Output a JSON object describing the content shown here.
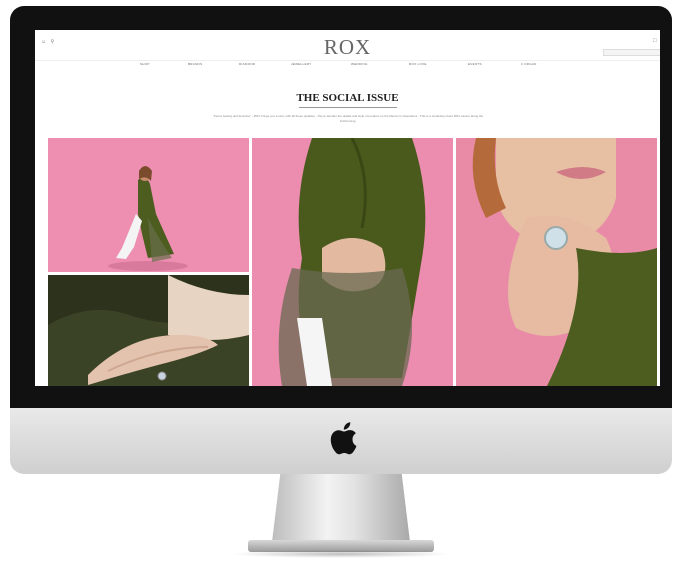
{
  "site": {
    "logo": "ROX",
    "left_icons": [
      "user-icon",
      "search-icon"
    ],
    "cart_icon": "bag-icon"
  },
  "nav": [
    "SHOP",
    "BRANDS",
    "DIAMOND",
    "JEWELLERY",
    "WEDDING",
    "ROX LOVE",
    "EVENTS",
    "3 ORGAN"
  ],
  "page": {
    "title": "THE SOCIAL ISSUE",
    "intro": "\"Fierce feeling and feminine\" - ROX brings you a story with all these qualities - Tonya Jennifer the details and style of produce on the Mentor in Operations - This is a workshop shoot ROX eleven along the forthcoming."
  },
  "photos": [
    {
      "name": "photo-model-pink-backdrop",
      "alt": "model-seated"
    },
    {
      "name": "photo-hand-ring-closeup",
      "alt": "hand-ring"
    },
    {
      "name": "photo-model-green-dress",
      "alt": "green-dress"
    },
    {
      "name": "photo-face-ring-closeup",
      "alt": "face-ring"
    }
  ],
  "colors": {
    "pink_backdrop": "#ec8daf",
    "olive_green": "#4a5a1c",
    "bezel": "#111111"
  }
}
